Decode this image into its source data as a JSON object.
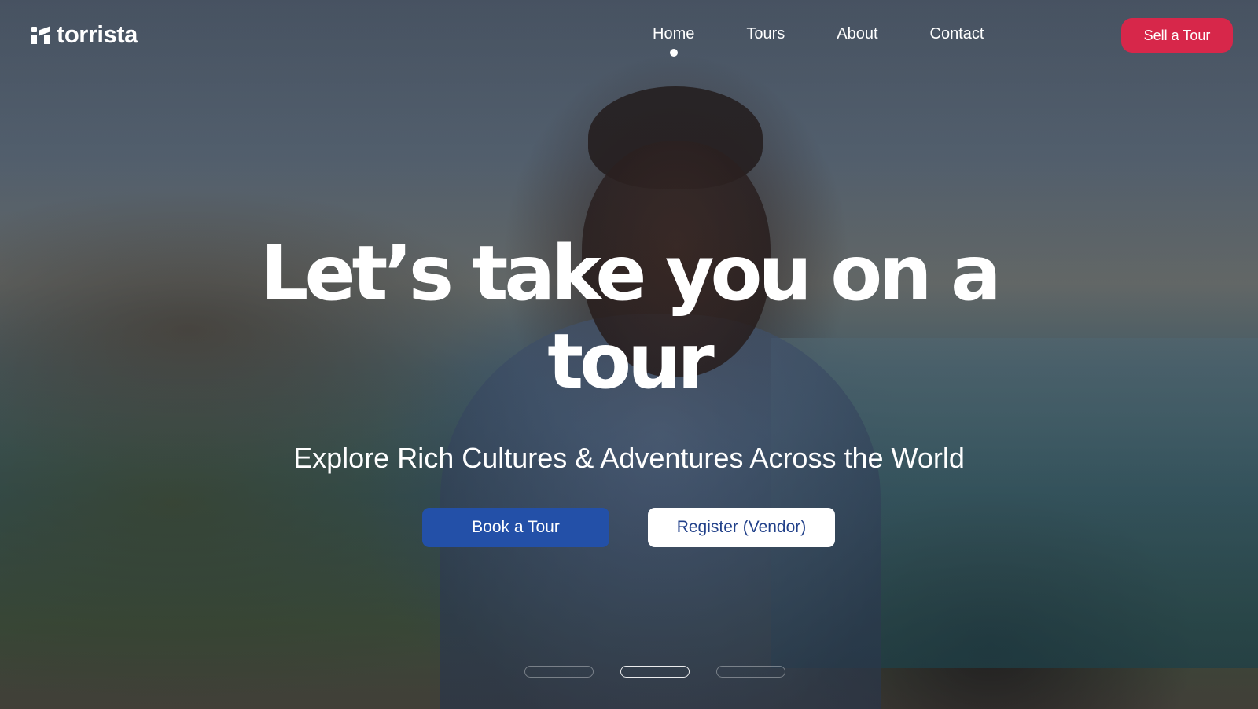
{
  "brand": {
    "name": "torrista"
  },
  "nav": {
    "items": [
      {
        "label": "Home",
        "active": true
      },
      {
        "label": "Tours",
        "active": false
      },
      {
        "label": "About",
        "active": false
      },
      {
        "label": "Contact",
        "active": false
      }
    ],
    "cta_label": "Sell a Tour"
  },
  "hero": {
    "headline_line1": "Let’s take you on a",
    "headline_line2": "tour",
    "subtitle": "Explore Rich Cultures & Adventures Across the World",
    "primary_button": "Book a Tour",
    "secondary_button": "Register (Vendor)"
  },
  "carousel": {
    "slide_count": 3,
    "active_index": 1
  },
  "colors": {
    "cta_red": "#d7274a",
    "primary_blue": "#2350a8",
    "secondary_text_blue": "#22418a"
  }
}
